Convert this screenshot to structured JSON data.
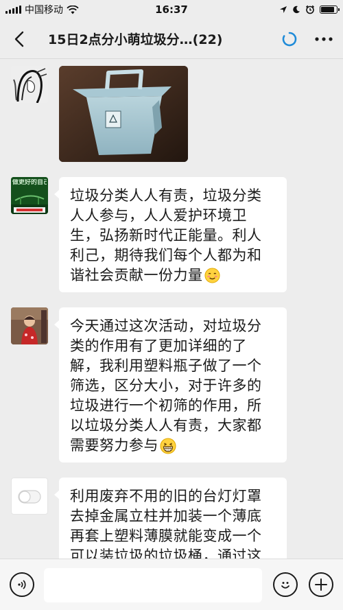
{
  "status_bar": {
    "carrier": "中国移动",
    "time": "16:37"
  },
  "nav": {
    "title": "15日2点分小萌垃圾分…(22)"
  },
  "messages": [
    {
      "type": "image",
      "avatar": "ink-sketch-portrait-avatar"
    },
    {
      "type": "text",
      "avatar": "green-poster-avatar",
      "avatar_caption": "做更好的自己",
      "lines": [
        "垃圾分类人人有责，垃圾分类",
        "人人参与，人人爱护环境卫",
        "生，弘扬新时代正能量。利人",
        "利己，期待我们每个人都为和",
        "谐社会贡献一份力量"
      ],
      "emoji": "blush-smile-emoji"
    },
    {
      "type": "text",
      "avatar": "child-photo-avatar",
      "lines": [
        "今天通过这次活动，对垃圾分",
        "类的作用有了更加详细的了",
        "解，我利用塑料瓶子做了一个",
        "筛选，区分大小，对于许多的",
        "垃圾进行一个初筛的作用，所",
        "以垃圾分类人人有责，大家都",
        "需要努力参与"
      ],
      "emoji": "grin-emoji"
    },
    {
      "type": "text",
      "avatar": "toggle-switch-avatar",
      "lines": [
        "利用废弃不用的旧的台灯灯罩",
        "去掉金属立柱并加装一个薄底",
        "再套上塑料薄膜就能变成一个",
        "可以装垃圾的垃圾桶，通过这"
      ]
    }
  ],
  "input_bar": {
    "voice_icon": "voice-icon",
    "emoji_icon": "emoji-icon",
    "add_icon": "add-icon"
  },
  "colors": {
    "background": "#ededed",
    "bubble": "#ffffff",
    "loading_accent": "#1f8bd8"
  }
}
